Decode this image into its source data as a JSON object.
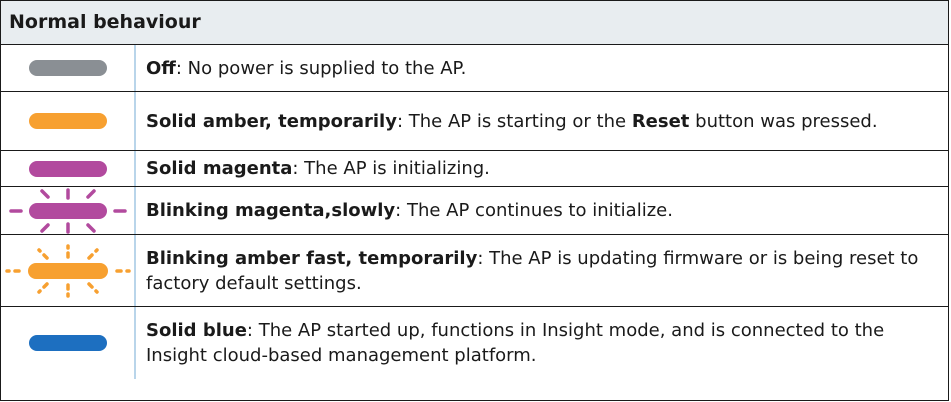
{
  "header": {
    "title": "Normal behaviour"
  },
  "colors": {
    "off": "#8a8f94",
    "amber": "#f7a030",
    "magenta": "#b24a9e",
    "blue": "#1d6fc0"
  },
  "rows": [
    {
      "icon": "led-off-icon",
      "bold": "Off",
      "text": ": No power is supplied to the AP."
    },
    {
      "icon": "led-solid-amber-icon",
      "bold": "Solid amber, temporarily",
      "text_a": ": The AP is starting or the ",
      "bold2": "Reset",
      "text_b": " button was pressed."
    },
    {
      "icon": "led-solid-magenta-icon",
      "bold": "Solid magenta",
      "text": ": The AP is initializing."
    },
    {
      "icon": "led-blinking-magenta-slow-icon",
      "bold": "Blinking magenta,slowly",
      "text": ": The AP continues to initialize."
    },
    {
      "icon": "led-blinking-amber-fast-icon",
      "bold": "Blinking amber fast, temporarily",
      "text": ": The AP is updating firmware or is being reset to factory default settings."
    },
    {
      "icon": "led-solid-blue-icon",
      "bold": "Solid blue",
      "text": ": The AP started up, functions in Insight mode, and is connected to the Insight cloud-based management platform."
    }
  ]
}
